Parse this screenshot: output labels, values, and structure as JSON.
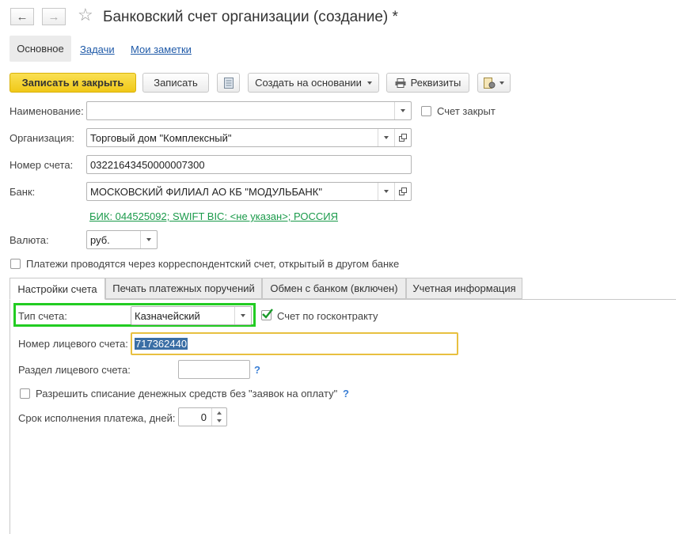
{
  "window": {
    "title": "Банковский счет организации (создание) *"
  },
  "nav_tabs": {
    "main": "Основное",
    "tasks": "Задачи",
    "notes": "Мои заметки"
  },
  "toolbar": {
    "save_close": "Записать и закрыть",
    "save": "Записать",
    "create_based_on": "Создать на основании",
    "requisites": "Реквизиты"
  },
  "form": {
    "name_label": "Наименование:",
    "name_value": "",
    "account_closed_label": "Счет закрыт",
    "org_label": "Организация:",
    "org_value": "Торговый дом \"Комплексный\"",
    "account_number_label": "Номер счета:",
    "account_number_value": "03221643450000007300",
    "bank_label": "Банк:",
    "bank_value": "МОСКОВСКИЙ ФИЛИАЛ АО КБ \"МОДУЛЬБАНК\"",
    "bank_info_link": "БИК: 044525092; SWIFT BIC: <не указан>; РОССИЯ",
    "currency_label": "Валюта:",
    "currency_value": "руб.",
    "corr_account_label": "Платежи проводятся через корреспондентский счет, открытый в другом банке"
  },
  "tabs": [
    {
      "label": "Настройки счета"
    },
    {
      "label": "Печать платежных поручений"
    },
    {
      "label": "Обмен с банком (включен)"
    },
    {
      "label": "Учетная информация"
    }
  ],
  "settings": {
    "account_type_label": "Тип счета:",
    "account_type_value": "Казначейский",
    "gov_contract_label": "Счет по госконтракту",
    "gov_contract_checked": true,
    "personal_account_label": "Номер лицевого счета:",
    "personal_account_value": "717362440",
    "personal_section_label": "Раздел лицевого счета:",
    "personal_section_value": "",
    "allow_debit_label": "Разрешить списание денежных средств без \"заявок на оплату\"",
    "payment_term_label": "Срок исполнения платежа, дней:",
    "payment_term_value": "0",
    "help_mark": "?"
  },
  "colors": {
    "accent_yellow": "#f0c818",
    "highlight_green": "#22cc22",
    "focus_border": "#e8c040",
    "link_green": "#1a9a4a",
    "selection": "#3a6ea5"
  }
}
